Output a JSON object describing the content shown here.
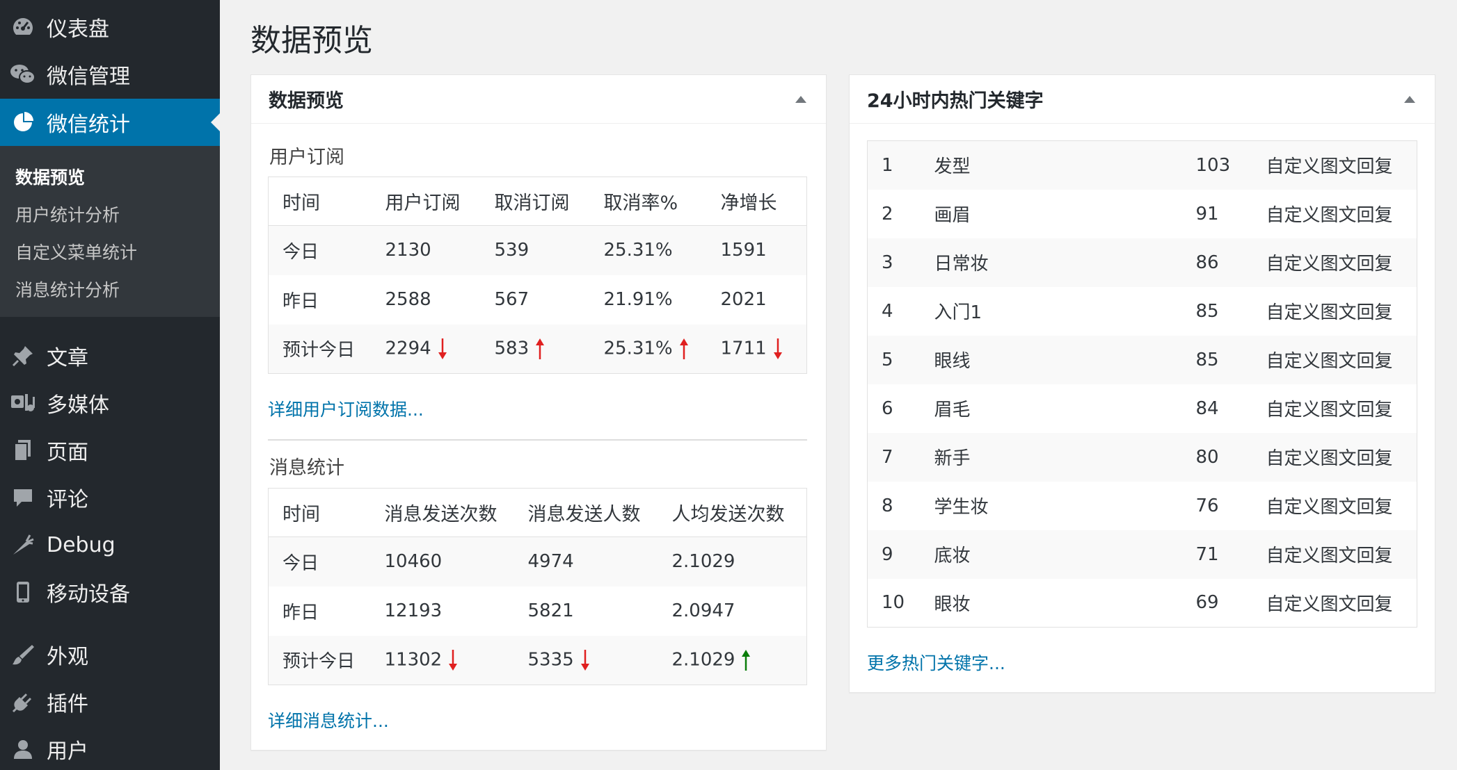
{
  "sidebar": {
    "items": [
      {
        "label": "仪表盘",
        "icon": "dashboard-icon"
      },
      {
        "label": "微信管理",
        "icon": "wechat-icon"
      },
      {
        "label": "微信统计",
        "icon": "pie-chart-icon",
        "active": true
      },
      {
        "label": "文章",
        "icon": "pushpin-icon"
      },
      {
        "label": "多媒体",
        "icon": "media-icon"
      },
      {
        "label": "页面",
        "icon": "page-icon"
      },
      {
        "label": "评论",
        "icon": "comment-icon"
      },
      {
        "label": "Debug",
        "icon": "carrot-icon"
      },
      {
        "label": "移动设备",
        "icon": "mobile-icon"
      },
      {
        "label": "外观",
        "icon": "paintbrush-icon"
      },
      {
        "label": "插件",
        "icon": "plugin-icon"
      },
      {
        "label": "用户",
        "icon": "user-icon"
      }
    ],
    "submenu": [
      "数据预览",
      "用户统计分析",
      "自定义菜单统计",
      "消息统计分析"
    ]
  },
  "page_title": "数据预览",
  "left_box": {
    "title": "数据预览",
    "subscribe": {
      "title": "用户订阅",
      "headers": [
        "时间",
        "用户订阅",
        "取消订阅",
        "取消率%",
        "净增长"
      ],
      "rows": [
        [
          "今日",
          "2130",
          "539",
          "25.31%",
          "1591"
        ],
        [
          "昨日",
          "2588",
          "567",
          "21.91%",
          "2021"
        ],
        [
          "预计今日",
          "2294",
          "583",
          "25.31%",
          "1711"
        ]
      ],
      "forecast_arrows": [
        "down",
        "up",
        "up",
        "down"
      ],
      "link": "详细用户订阅数据..."
    },
    "messages": {
      "title": "消息统计",
      "headers": [
        "时间",
        "消息发送次数",
        "消息发送人数",
        "人均发送次数"
      ],
      "rows": [
        [
          "今日",
          "10460",
          "4974",
          "2.1029"
        ],
        [
          "昨日",
          "12193",
          "5821",
          "2.0947"
        ],
        [
          "预计今日",
          "11302",
          "5335",
          "2.1029"
        ]
      ],
      "forecast_arrows": [
        "down",
        "down",
        "up"
      ],
      "link": "详细消息统计..."
    }
  },
  "right_box": {
    "title": "24小时内热门关键字",
    "keywords": [
      [
        "1",
        "发型",
        "103",
        "自定义图文回复"
      ],
      [
        "2",
        "画眉",
        "91",
        "自定义图文回复"
      ],
      [
        "3",
        "日常妆",
        "86",
        "自定义图文回复"
      ],
      [
        "4",
        "入门1",
        "85",
        "自定义图文回复"
      ],
      [
        "5",
        "眼线",
        "85",
        "自定义图文回复"
      ],
      [
        "6",
        "眉毛",
        "84",
        "自定义图文回复"
      ],
      [
        "7",
        "新手",
        "80",
        "自定义图文回复"
      ],
      [
        "8",
        "学生妆",
        "76",
        "自定义图文回复"
      ],
      [
        "9",
        "底妆",
        "71",
        "自定义图文回复"
      ],
      [
        "10",
        "眼妆",
        "69",
        "自定义图文回复"
      ]
    ],
    "link": "更多热门关键字..."
  },
  "colors": {
    "sidebar": "#23282d",
    "active": "#0073aa",
    "link": "#0073aa",
    "arrow_down": "#e02020",
    "arrow_up_red": "#e02020",
    "arrow_up_green": "#0a7d0a"
  }
}
